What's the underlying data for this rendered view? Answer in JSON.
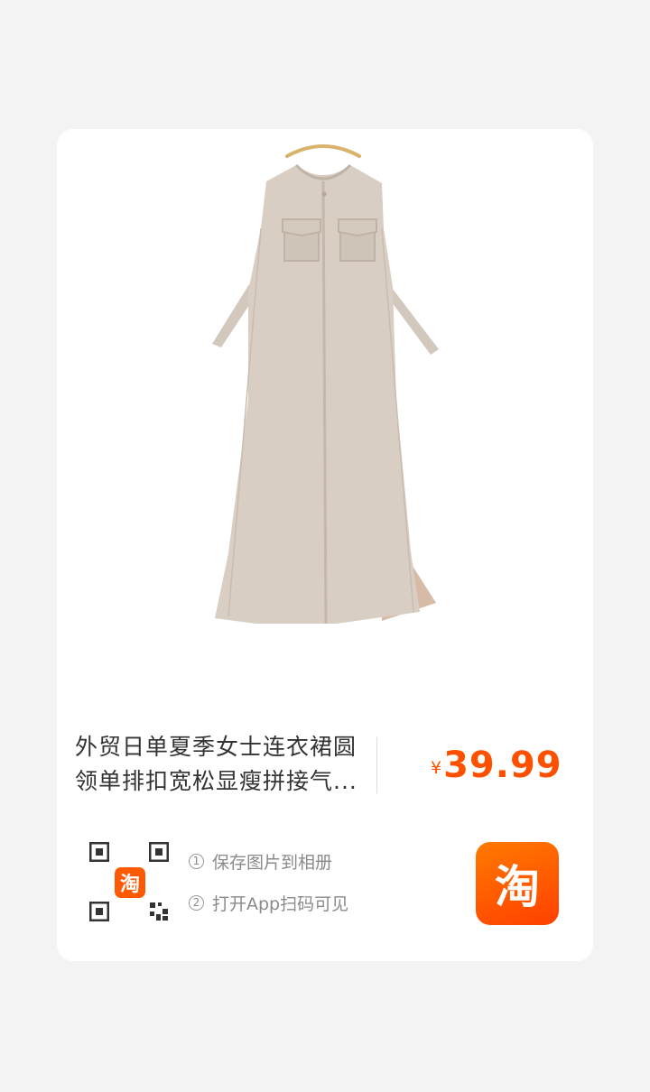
{
  "product": {
    "title_line1": "外贸日单夏季女士连衣裙圆",
    "title_line2": "领单排扣宽松显瘦拼接气...",
    "price_symbol": "¥",
    "price": "39.99",
    "image": "sleeveless-beige-shirt-dress-image"
  },
  "share": {
    "step1_number": "①",
    "step1": "保存图片到相册",
    "step2_number": "②",
    "step2": "打开App扫码可见",
    "qr_badge_char": "淘",
    "app_icon_char": "淘"
  },
  "colors": {
    "accent": "#ff5000",
    "background": "#f3f3f3",
    "card": "#ffffff"
  }
}
